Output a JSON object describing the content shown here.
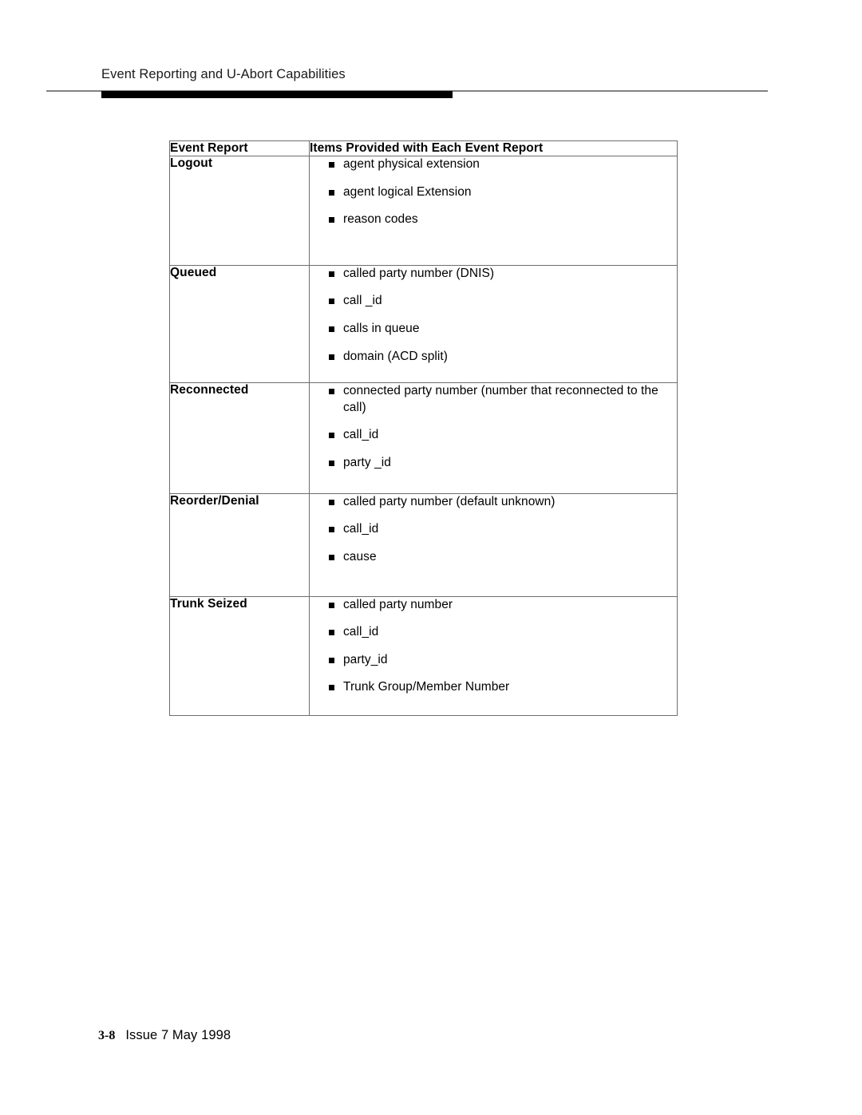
{
  "page": {
    "running_head": "Event Reporting and U-Abort Capabilities",
    "footer": {
      "folio": "3-8",
      "issue": "Issue  7 May 1998"
    }
  },
  "table": {
    "columns": [
      "Event Report",
      "Items Provided with Each Event Report"
    ],
    "rows": [
      {
        "label": "Logout",
        "items": [
          "agent physical extension",
          "agent logical Extension",
          "reason codes"
        ]
      },
      {
        "label": "Queued",
        "items": [
          "called party number (DNIS)",
          "call _id",
          "calls in queue",
          "domain (ACD split)"
        ]
      },
      {
        "label": "Reconnected",
        "items": [
          "connected party number (number that reconnected to the call)",
          "call_id",
          "party _id"
        ]
      },
      {
        "label": "Reorder/Denial",
        "items": [
          "called party number (default unknown)",
          "call_id",
          "cause"
        ]
      },
      {
        "label": "Trunk Seized",
        "items": [
          "called party number",
          "call_id",
          "party_id",
          "Trunk Group/Member Number"
        ]
      }
    ]
  }
}
